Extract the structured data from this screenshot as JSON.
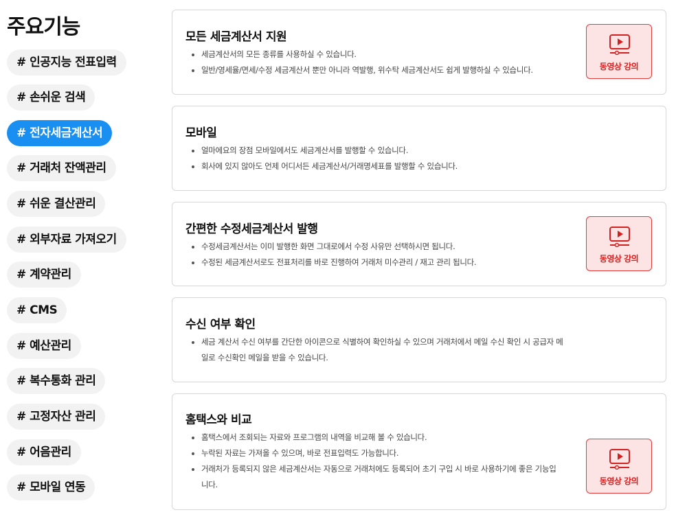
{
  "sidebar": {
    "title": "주요기능",
    "tags": [
      {
        "label": "# 인공지능 전표입력"
      },
      {
        "label": "# 손쉬운 검색"
      },
      {
        "label": "# 전자세금계산서",
        "active": true
      },
      {
        "label": "# 거래처 잔액관리"
      },
      {
        "label": "# 쉬운 결산관리"
      },
      {
        "label": "# 외부자료 가져오기"
      },
      {
        "label": "# 계약관리"
      },
      {
        "label": "# CMS"
      },
      {
        "label": "# 예산관리"
      },
      {
        "label": "# 복수통화 관리"
      },
      {
        "label": "# 고정자산 관리"
      },
      {
        "label": "# 어음관리"
      },
      {
        "label": "# 모바일 연동"
      }
    ]
  },
  "features": [
    {
      "title": "모든 세금계산서 지원",
      "bullets": [
        "세금계산서의 모든 종류를 사용하실 수 있습니다.",
        "일반/영세율/면세/수정 세금계산서 뿐만 아니라 역발행, 위수탁 세금계산서도 쉽게 발행하실 수 있습니다."
      ],
      "video_label": "동영상 강의"
    },
    {
      "title": "모바일",
      "bullets": [
        "얼마에요의 장점 모바일에서도 세금계산서를 발행할 수 있습니다.",
        "회사에 있지 않아도 언제 어디서든 세금계산서/거래명세표를 발행할 수 있습니다."
      ]
    },
    {
      "title": "간편한 수정세금계산서 발행",
      "bullets": [
        "수정세금계산서는 이미 발행한 화면 그대로에서 수정 사유만 선택하시면 됩니다.",
        "수정된 세금계산서로도 전표처리를 바로 진행하여 거래처 미수관리 / 재고 관리 됩니다."
      ],
      "video_label": "동영상 강의"
    },
    {
      "title": "수신 여부 확인",
      "bullets": [
        "세금 계산서 수신 여부를 간단한 아이콘으로 식별하여 확인하실 수 있으며 거래처에서 메일 수신 확인 시 공급자 메일로 수신확인 메일을 받을 수 있습니다."
      ]
    },
    {
      "title": "홈택스와 비교",
      "bullets": [
        "홈택스에서 조회되는 자료와 프로그램의 내역을 비교해 볼 수 있습니다.",
        "누락된 자료는 가져올 수 있으며, 바로 전표입력도 가능합니다.",
        "거래처가 등록되지 않은 세금계산서는 자동으로 거래처에도 등록되어 초기 구입 시 바로 사용하기에 좋은 기능입니다."
      ],
      "video_label": "동영상 강의"
    }
  ],
  "icons": {
    "video": "play-video-icon"
  },
  "colors": {
    "accent": "#1a8ff2",
    "video_border": "#e23a3a",
    "video_bg": "#fde4e4",
    "video_text": "#d42020"
  }
}
